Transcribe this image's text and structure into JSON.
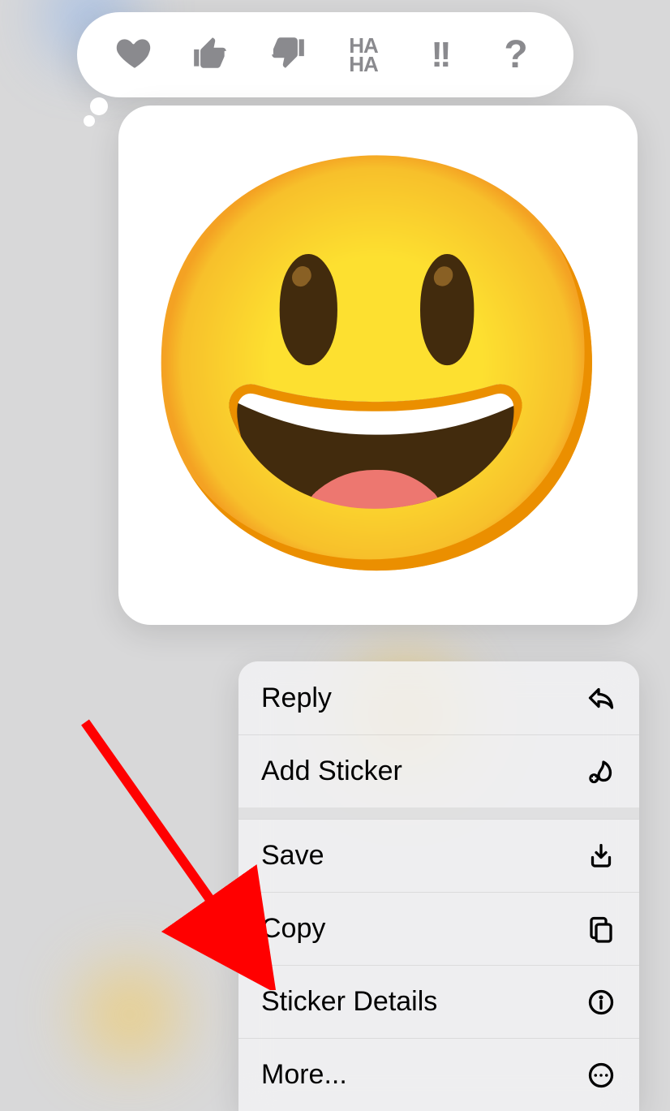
{
  "reactions": {
    "heart": "heart",
    "thumbs_up": "thumbs-up",
    "thumbs_down": "thumbs-down",
    "haha_top": "HA",
    "haha_bottom": "HA",
    "exclaim": "!!",
    "question": "?"
  },
  "sticker": {
    "emoji": "😃"
  },
  "menu": {
    "reply": "Reply",
    "add_sticker": "Add Sticker",
    "save": "Save",
    "copy": "Copy",
    "sticker_details": "Sticker Details",
    "more": "More..."
  }
}
